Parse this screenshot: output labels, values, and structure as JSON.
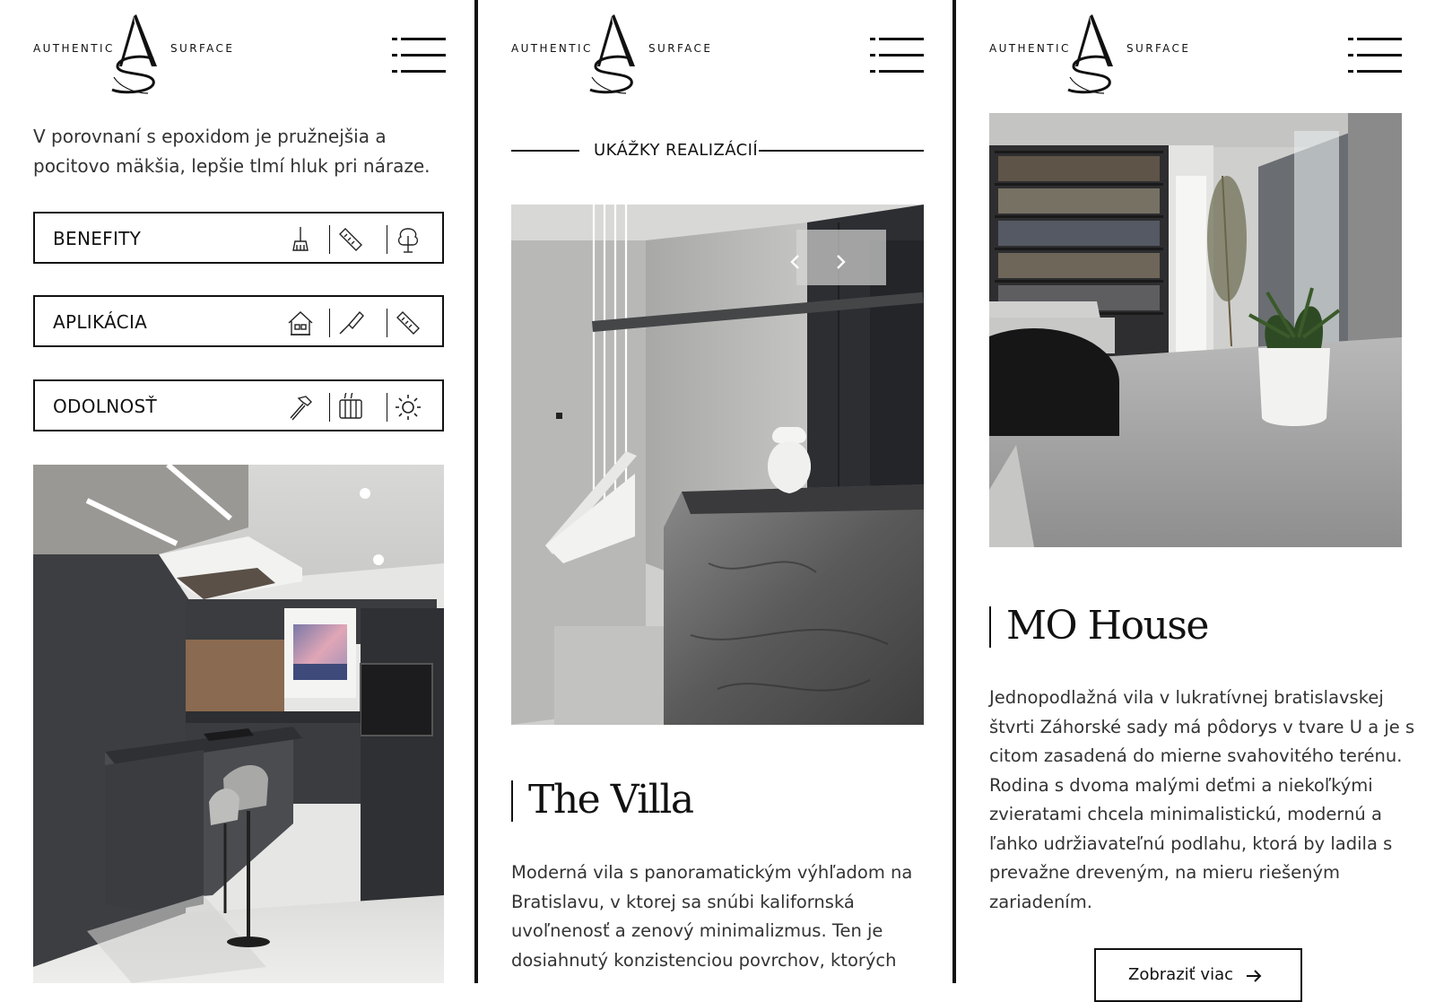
{
  "brand": {
    "left_word": "AUTHENTIC",
    "right_word": "SURFACE"
  },
  "panel1": {
    "intro": "V porovnaní s epoxidom je pružnejšia a pocitovo mäkšia, lepšie tlmí hluk pri náraze.",
    "accordions": [
      {
        "label": "BENEFITY",
        "icons": [
          "broom-icon",
          "ruler-icon",
          "tree-icon"
        ]
      },
      {
        "label": "APLIKÁCIA",
        "icons": [
          "house-icon",
          "trowel-icon",
          "ruler-icon"
        ]
      },
      {
        "label": "ODOLNOSŤ",
        "icons": [
          "hammer-icon",
          "radiator-icon",
          "sun-icon"
        ]
      }
    ]
  },
  "panel2": {
    "section_title": "UKÁŽKY REALIZÁCIÍ",
    "project_title": "The Villa",
    "project_text": "Moderná vila s panoramatickým výhľadom na Bratislavu, v ktorej sa snúbi kalifornská uvoľnenosť a zenový minimalizmus. Ten je dosiahnutý konzistenciou povrchov, ktorých"
  },
  "panel3": {
    "project_title": "MO House",
    "project_text": "Jednopodlažná vila v lukratívnej bratislavskej štvrti Záhorské sady má pôdorys v tvare U a je s citom zasadená do mierne svahovitého terénu. Rodina s dvoma malými deťmi a niekoľkými zvieratami chcela minimalistickú, modernú a ľahko udržiavateľnú podlahu, ktorá by ladila s prevažne dreveným, na mieru riešeným zariadením.",
    "more_button": "Zobraziť viac"
  },
  "colors": {
    "border": "#111111",
    "text": "#333333",
    "background": "#ffffff"
  }
}
